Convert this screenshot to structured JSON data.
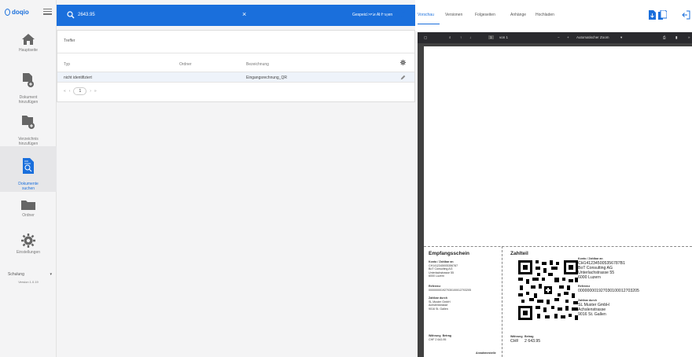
{
  "app": {
    "logo_text": "doqio"
  },
  "sidebar": {
    "items": [
      {
        "label": "Hauptseite"
      },
      {
        "label": "Dokument\nhinzufügen"
      },
      {
        "label": "Verzeichnis\nhinzufügen"
      },
      {
        "label": "Dokumente\nsuchen"
      },
      {
        "label": "Ordner"
      },
      {
        "label": "Einstellungen"
      }
    ],
    "select_value": "Schulung",
    "version": "Version 1.0.19"
  },
  "search": {
    "query": "2643.95",
    "saved_queries_label": "Gespeicherte Abfragen"
  },
  "results": {
    "title": "Treffer",
    "columns": [
      "Typ",
      "Ordner",
      "Bezeichnung"
    ],
    "rows": [
      {
        "typ": "nicht identifiziert",
        "ordner": "",
        "bezeichnung": "Eingangsrechnung_QR"
      }
    ],
    "pager": {
      "current_page": "1"
    }
  },
  "preview_tabs": [
    "Vorschau",
    "Versionen",
    "Folgeseiten",
    "Anhänge",
    "Hochladen"
  ],
  "pdf_toolbar": {
    "page_input": "1",
    "page_of": "von 1",
    "zoom_label": "Automatischer Zoom"
  },
  "bill": {
    "receipt_title": "Empfangsschein",
    "receipt_account_head": "Konto / Zahlbar an",
    "receipt_account": "CH1412345005356787\nBoT Consulting AG\nUnterlachstrasse 55\n6000 Luzern",
    "receipt_ref_head": "Referenz",
    "receipt_ref": "000000001927030100012703205",
    "receipt_payer_head": "Zahlbar durch",
    "receipt_payer": "SL Muster GmbH\nAchslenstrasse\n9016 St. Gallen",
    "receipt_amount_head": "Währung  Betrag",
    "receipt_amount": "CHF 2 643.95",
    "receipt_acceptance": "Annahmestelle",
    "payment_title": "Zahlteil",
    "payment_account_head": "Konto / Zahlbar an",
    "payment_account": "CH1412345005356787B1\nBoT Consulting AG\nUnterlachstrasse 55\n6000 Luzern",
    "payment_ref_head": "Referenz",
    "payment_ref": "000000001927030100012703205",
    "payment_payer_head": "Zahlbar durch",
    "payment_payer": "SL Muster GmbH\nAchslenstrasse\n9016 St. Gallen",
    "payment_currency_head": "Währung",
    "payment_amount_head": "Betrag",
    "payment_currency": "CHF",
    "payment_amount": "2 643.95"
  },
  "colors": {
    "accent": "#1a6fdc",
    "sidebar_bg": "#f4f4f5",
    "pdf_bg": "#404040"
  }
}
